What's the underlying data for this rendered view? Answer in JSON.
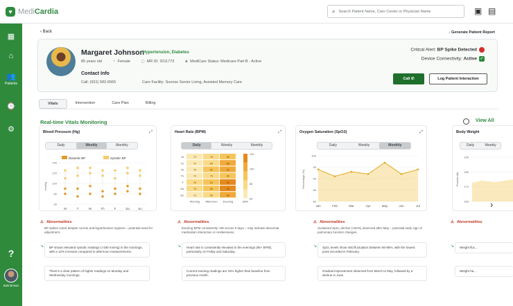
{
  "app": {
    "logo_part1": "Medi",
    "logo_part2": "Cardia"
  },
  "search": {
    "placeholder": "Search Patient Name, Care Center or Physician Name"
  },
  "sidebar": {
    "items": [
      {
        "label": ""
      },
      {
        "label": ""
      },
      {
        "label": "Patients"
      },
      {
        "label": ""
      },
      {
        "label": ""
      }
    ],
    "help": "?",
    "user_name": "Bob Brown"
  },
  "nav": {
    "back": "Back",
    "report": "Generate Patient Report"
  },
  "patient": {
    "name": "Margaret Johnson",
    "conditions": "Hypertension, Diabetes",
    "age": "85 years old",
    "gender": "Female",
    "mrid": "MR ID: 2011773",
    "medicare": "MediCare Status: Medicare Part B - Active",
    "contact_title": "Contact Info",
    "call": "Call: (931) 582-6565",
    "care_facility": "Care Facility: Sunrise Senior Living, Assisted Memory Care",
    "critical_alert_label": "Critical Alert:",
    "critical_alert_value": "BP Spike Detected",
    "device_label": "Device Connectivity:",
    "device_value": "Active",
    "call_button": "Call",
    "log_button": "Log Patient Interaction"
  },
  "tabs": [
    "Vitals",
    "Intervention",
    "Care Plan",
    "Billing"
  ],
  "section_title": "Real-time Vitals Monitoring",
  "view_all": "View All",
  "seg_labels": [
    "Daily",
    "Weekly",
    "Monthly"
  ],
  "cards": {
    "bp": {
      "title": "Blood Pressure (Hg)",
      "legend": [
        "Diastolic BP",
        "Systolic BP"
      ],
      "ylabel": "mmHg",
      "abnormalities": "Abnormalities",
      "abn_text": "BP spikes noted despite current anti-hypertensive regimen – potential need for adjustment.",
      "notes": [
        "BP shows elevated systolic readings (>180 mmHg) in the mornings, with a 12% increase compared to afternoon measurements.",
        "There's a clear pattern of higher readings on Monday and Wednesday mornings."
      ]
    },
    "hr": {
      "title": "Heart Rate (BPM)",
      "abnormalities": "Abnormalities",
      "abn_text": "Evening BPM consistently >95 across 6 days – may indicate abnormal medication interaction or restlessness.",
      "notes": [
        "Heart rate is consistently elevated in the evenings (95+ BPM), particularly on Friday and Saturday.",
        "Current evening readings are 15% higher than baseline from previous month."
      ]
    },
    "spo2": {
      "title": "Oxygen Saturation (SpO2)",
      "ylabel": "Percentage (%)",
      "abnormalities": "Abnormalities",
      "abn_text": "Sustained SpO₂ decline (<92%) observed after May – potential early sign of pulmonary function changes.",
      "notes": [
        "SpO₂ levels show mild fluctuation between 90-95%, with the lowest point recorded in February.",
        "Gradual improvement observed from March to May, followed by a decline in June."
      ]
    },
    "weight": {
      "title": "Body Weight",
      "ylabel": "Pounds (lb)",
      "abnormalities": "Abnormalities",
      "abn_text": "",
      "notes": [
        "Weight fluc...",
        "Weight ha..."
      ]
    }
  },
  "chart_data": [
    {
      "type": "scatter",
      "title": "Blood Pressure (Hg)",
      "categories": [
        "M",
        "T",
        "W",
        "Th",
        "F",
        "Sa",
        "Su"
      ],
      "series": [
        {
          "name": "Diastolic BP",
          "values": [
            [
              80,
              90
            ],
            [
              75,
              90
            ],
            [
              80,
              95
            ],
            [
              75,
              85
            ],
            [
              80,
              90
            ],
            [
              85,
              95
            ],
            [
              80,
              90
            ]
          ]
        },
        {
          "name": "Systolic BP",
          "values": [
            [
              110,
              125
            ],
            [
              115,
              130
            ],
            [
              120,
              130
            ],
            [
              115,
              125
            ],
            [
              110,
              125
            ],
            [
              120,
              130
            ],
            [
              115,
              125
            ]
          ]
        }
      ],
      "ylim": [
        60,
        140
      ],
      "yticks": [
        140,
        120,
        100,
        80,
        60
      ]
    },
    {
      "type": "heatmap",
      "title": "Heart Rate (BPM)",
      "rows": [
        "M",
        "Tu",
        "W",
        "Th",
        "F",
        "Sa",
        "Su"
      ],
      "columns": [
        "Morning",
        "Afternoon",
        "Evening"
      ],
      "values": [
        [
          72,
          78,
          85
        ],
        [
          70,
          80,
          88
        ],
        [
          75,
          82,
          90
        ],
        [
          74,
          79,
          86
        ],
        [
          76,
          84,
          96
        ],
        [
          78,
          86,
          98
        ],
        [
          72,
          80,
          88
        ]
      ],
      "scale_ticks": [
        120,
        100,
        80,
        60
      ]
    },
    {
      "type": "area",
      "title": "Oxygen Saturation (SpO2)",
      "categories": [
        "Jan",
        "Feb",
        "Mar",
        "Apr",
        "May",
        "Jun",
        "Jul"
      ],
      "values": [
        94,
        91,
        93,
        92,
        97,
        92,
        94
      ],
      "ylim": [
        80,
        100
      ],
      "yticks": [
        100,
        95,
        90,
        85,
        80
      ]
    },
    {
      "type": "area",
      "title": "Body Weight",
      "yticks": [
        190,
        180,
        170,
        160
      ]
    }
  ],
  "colors": {
    "brand": "#2e8b3e",
    "alert": "#d32f2f",
    "bp_dia": "#e39a2d",
    "bp_sys": "#f3cc6d",
    "area": "#f0c040"
  }
}
